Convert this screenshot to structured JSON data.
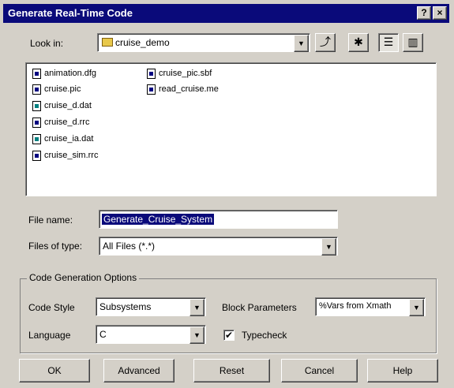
{
  "window": {
    "title": "Generate Real-Time Code",
    "help_btn": "?",
    "close_btn": "×"
  },
  "lookin": {
    "label": "Look in:",
    "folder": "cruise_demo"
  },
  "files": [
    {
      "name": "animation.dfg",
      "type": "doc"
    },
    {
      "name": "cruise.pic",
      "type": "doc"
    },
    {
      "name": "cruise_d.dat",
      "type": "dat"
    },
    {
      "name": "cruise_d.rrc",
      "type": "doc"
    },
    {
      "name": "cruise_ia.dat",
      "type": "dat"
    },
    {
      "name": "cruise_sim.rrc",
      "type": "doc"
    },
    {
      "name": "cruise_pic.sbf",
      "type": "doc"
    },
    {
      "name": "read_cruise.me",
      "type": "doc"
    }
  ],
  "filename": {
    "label": "File name:",
    "value": "Generate_Cruise_System"
  },
  "filetype": {
    "label": "Files of type:",
    "value": "All Files (*.*)"
  },
  "options": {
    "group_title": "Code Generation Options",
    "code_style_label": "Code Style",
    "code_style_value": "Subsystems",
    "language_label": "Language",
    "language_value": "C",
    "block_params_label": "Block Parameters",
    "block_params_value": "%Vars from Xmath",
    "typecheck_label": "Typecheck",
    "typecheck_checked": "✔"
  },
  "buttons": {
    "ok": "OK",
    "advanced": "Advanced",
    "reset": "Reset",
    "cancel": "Cancel",
    "help": "Help"
  },
  "icons": {
    "dropdown": "▼",
    "up_folder": "⤴",
    "new_folder": "✱",
    "list_view": "☰",
    "details_view": "▥"
  }
}
